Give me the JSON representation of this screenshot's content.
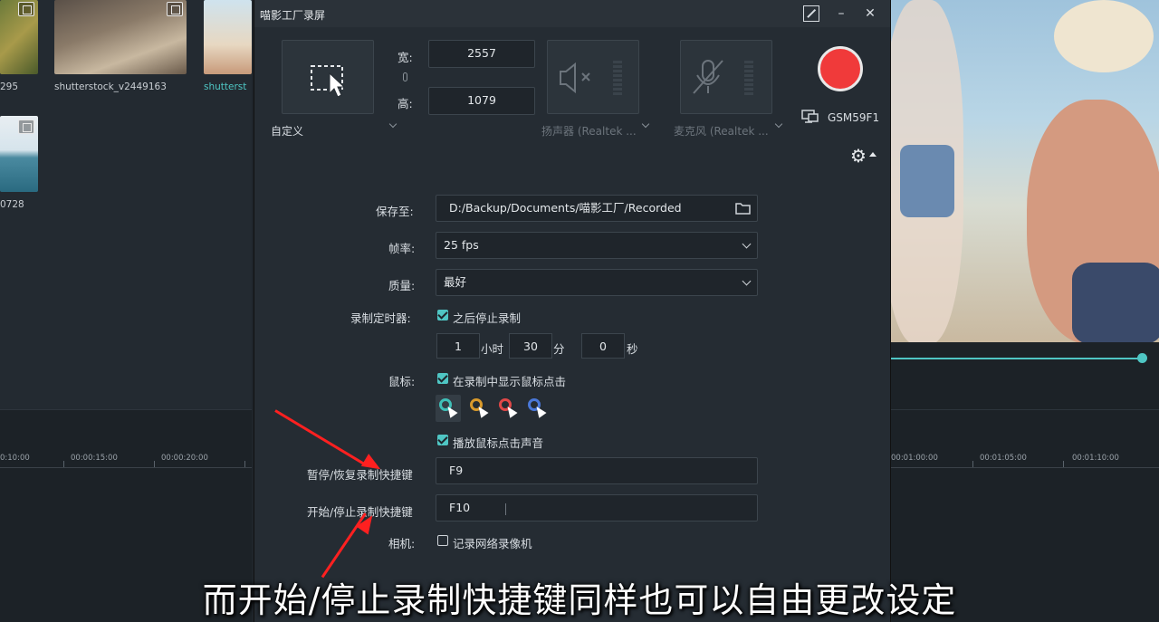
{
  "background": {
    "thumbnails": [
      {
        "label": "295",
        "active": false
      },
      {
        "label": "shutterstock_v2449163",
        "active": false
      },
      {
        "label": "shutterst",
        "active": true
      },
      {
        "label": "0728",
        "active": false
      }
    ],
    "timeline_left_ticks": [
      "0:10:00",
      "00:00:15:00",
      "00:00:20:00"
    ],
    "timeline_right_ticks": [
      "00:01:00:00",
      "00:01:05:00",
      "00:01:10:00"
    ]
  },
  "dialog": {
    "title": "喵影工厂录屏",
    "minimize": "–",
    "close": "✕",
    "region": {
      "preset": "自定义"
    },
    "width_label": "宽:",
    "height_label": "高:",
    "width_value": "2557",
    "height_value": "1079",
    "speaker_label": "扬声器 (Realtek ...",
    "mic_label": "麦克风 (Realtek ...",
    "monitor_label": "GSM59F1",
    "settings": {
      "save_to_label": "保存至:",
      "save_to_value": "D:/Backup/Documents/喵影工厂/Recorded",
      "fps_label": "帧率:",
      "fps_value": "25 fps",
      "quality_label": "质量:",
      "quality_value": "最好",
      "timer_label": "录制定时器:",
      "timer_check": "之后停止录制",
      "hours": "1",
      "hours_unit": "小时",
      "minutes": "30",
      "minutes_unit": "分",
      "seconds": "0",
      "seconds_unit": "秒",
      "mouse_label": "鼠标:",
      "mouse_check": "在录制中显示鼠标点击",
      "mouse_sound_check": "播放鼠标点击声音",
      "pause_hotkey_label": "暂停/恢复录制快捷键",
      "pause_hotkey_value": "F9",
      "start_hotkey_label": "开始/停止录制快捷键",
      "start_hotkey_value": "F10",
      "camera_label": "相机:",
      "camera_check": "记录网络录像机"
    },
    "cursor_colors": [
      "#3fc0b8",
      "#d99a2b",
      "#e04848",
      "#4a78d8"
    ]
  },
  "subtitle": "而开始/停止录制快捷键同样也可以自由更改设定",
  "colors": {
    "accent": "#4fc6c4",
    "record": "#f03a3a",
    "annotation": "#ff2020"
  }
}
